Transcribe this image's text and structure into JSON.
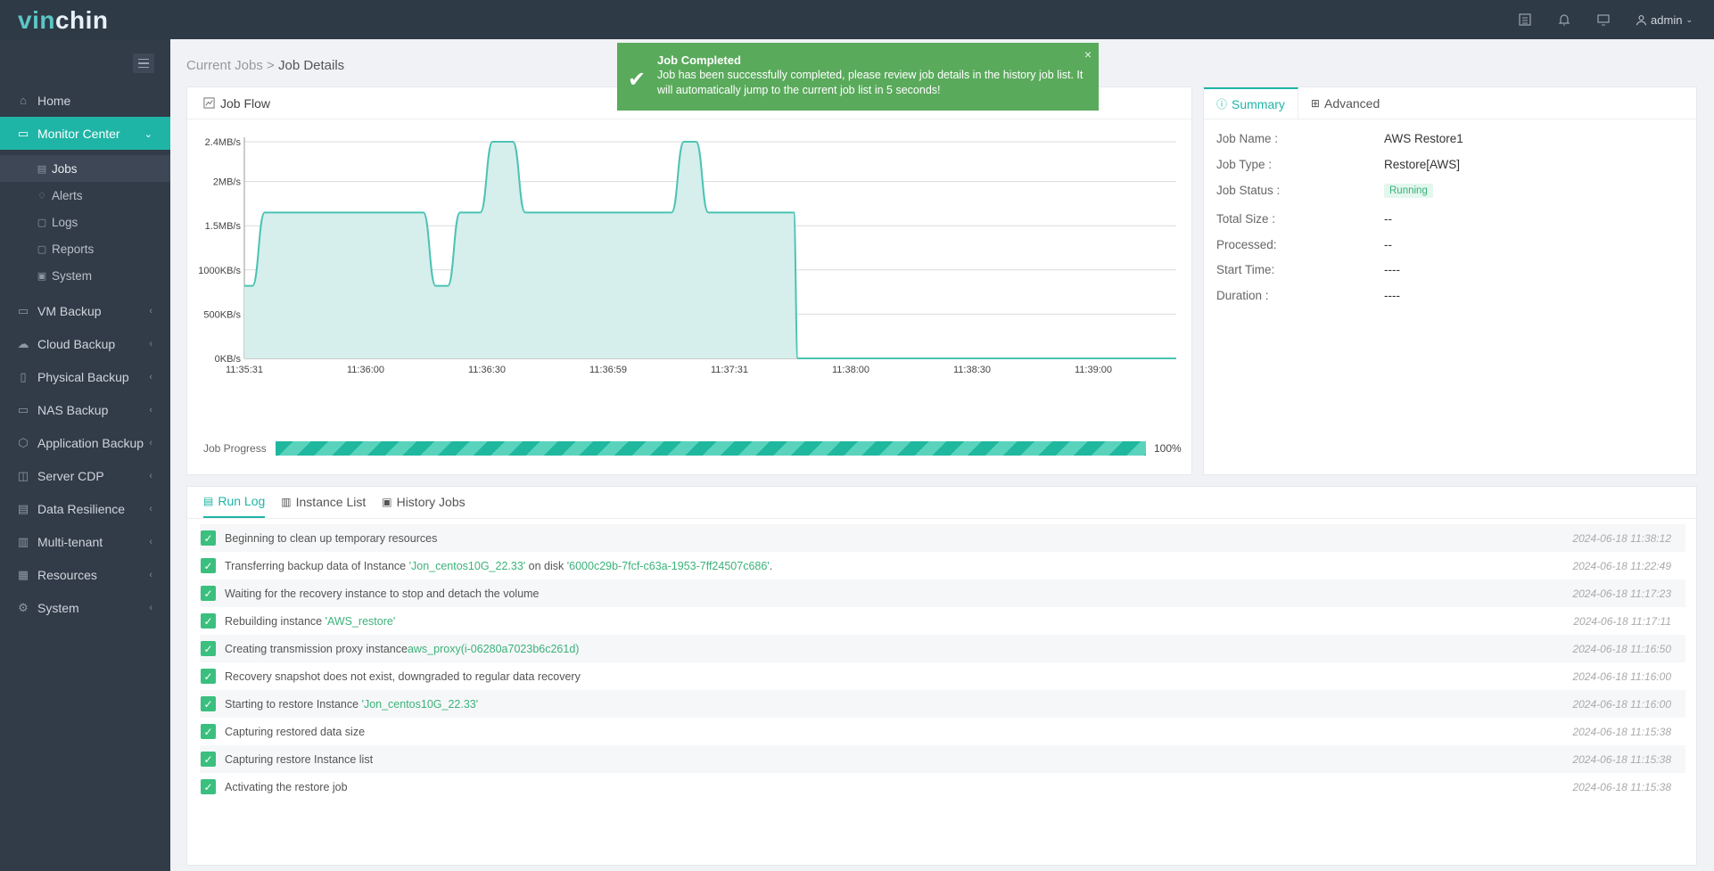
{
  "brand": {
    "logo_part1": "vin",
    "logo_part2": "chin"
  },
  "topbar": {
    "user": "admin",
    "icons": [
      "list-icon",
      "bell-icon",
      "monitor-icon",
      "user-icon",
      "chevron-down-icon"
    ]
  },
  "sidebar": {
    "items": [
      {
        "label": "Home",
        "icon": "home-icon"
      },
      {
        "label": "Monitor Center",
        "icon": "monitor-icon",
        "active": true
      },
      {
        "label": "VM Backup",
        "icon": "vm-icon"
      },
      {
        "label": "Cloud Backup",
        "icon": "cloud-icon"
      },
      {
        "label": "Physical Backup",
        "icon": "server-icon"
      },
      {
        "label": "NAS Backup",
        "icon": "nas-icon"
      },
      {
        "label": "Application Backup",
        "icon": "app-icon"
      },
      {
        "label": "Server CDP",
        "icon": "cdp-icon"
      },
      {
        "label": "Data Resilience",
        "icon": "resilience-icon"
      },
      {
        "label": "Multi-tenant",
        "icon": "tenant-icon"
      },
      {
        "label": "Resources",
        "icon": "resources-icon"
      },
      {
        "label": "System",
        "icon": "gear-icon"
      }
    ],
    "subitems": [
      {
        "label": "Jobs",
        "active": true
      },
      {
        "label": "Alerts"
      },
      {
        "label": "Logs"
      },
      {
        "label": "Reports"
      },
      {
        "label": "System"
      }
    ]
  },
  "breadcrumb": {
    "parent": "Current Jobs",
    "separator": ">",
    "current": "Job Details"
  },
  "jobflow": {
    "title": "Job Flow",
    "progress_label": "Job Progress",
    "progress_value": 100,
    "progress_text": "100%"
  },
  "chart_data": {
    "type": "area",
    "x": [
      "11:35:31",
      "11:36:00",
      "11:36:30",
      "11:36:59",
      "11:37:31",
      "11:38:00",
      "11:38:30",
      "11:39:00"
    ],
    "y_ticks": [
      "0KB/s",
      "500KB/s",
      "1000KB/s",
      "1.5MB/s",
      "2MB/s",
      "2.4MB/s"
    ],
    "ylim": [
      0,
      2.5
    ],
    "y_unit": "MB/s",
    "points": [
      [
        0,
        0.82
      ],
      [
        2,
        0.82
      ],
      [
        5,
        1.65
      ],
      [
        44,
        1.65
      ],
      [
        47,
        0.82
      ],
      [
        50,
        0.82
      ],
      [
        53,
        1.65
      ],
      [
        58,
        1.65
      ],
      [
        61,
        2.45
      ],
      [
        66,
        2.45
      ],
      [
        69,
        1.65
      ],
      [
        105,
        1.65
      ],
      [
        108,
        2.45
      ],
      [
        111,
        2.45
      ],
      [
        114,
        1.65
      ],
      [
        135,
        1.65
      ],
      [
        136,
        0
      ],
      [
        229,
        0
      ]
    ],
    "x_range": [
      0,
      229
    ],
    "grid": true
  },
  "summary": {
    "tabs": [
      {
        "label": "Summary",
        "active": true
      },
      {
        "label": "Advanced"
      }
    ],
    "rows": [
      {
        "key": "Job Name :",
        "value": "AWS Restore1"
      },
      {
        "key": "Job Type :",
        "value": "Restore[AWS]"
      },
      {
        "key": "Job Status :",
        "value": "Running",
        "badge": true
      },
      {
        "key": "Total Size :",
        "value": "--"
      },
      {
        "key": "Processed:",
        "value": "--"
      },
      {
        "key": "Start Time:",
        "value": "----"
      },
      {
        "key": "Duration :",
        "value": "----"
      }
    ]
  },
  "runlog": {
    "tabs": [
      {
        "label": "Run Log",
        "active": true
      },
      {
        "label": "Instance List"
      },
      {
        "label": "History Jobs"
      }
    ],
    "entries": [
      {
        "parts": [
          {
            "t": "Beginning to clean up temporary resources"
          }
        ],
        "ts": "2024-06-18 11:38:12"
      },
      {
        "parts": [
          {
            "t": "Transferring backup data of Instance "
          },
          {
            "t": "'Jon_centos10G_22.33'",
            "hl": true
          },
          {
            "t": " on disk "
          },
          {
            "t": "'6000c29b-7fcf-c63a-1953-7ff24507c686'",
            "hl": true
          },
          {
            "t": "."
          }
        ],
        "ts": "2024-06-18 11:22:49"
      },
      {
        "parts": [
          {
            "t": "Waiting for the recovery instance to stop and detach the volume"
          }
        ],
        "ts": "2024-06-18 11:17:23"
      },
      {
        "parts": [
          {
            "t": "Rebuilding instance "
          },
          {
            "t": "'AWS_restore'",
            "hl": true
          }
        ],
        "ts": "2024-06-18 11:17:11"
      },
      {
        "parts": [
          {
            "t": "Creating transmission proxy instance"
          },
          {
            "t": "aws_proxy(i-06280a7023b6c261d)",
            "hl": true
          }
        ],
        "ts": "2024-06-18 11:16:50"
      },
      {
        "parts": [
          {
            "t": "Recovery snapshot does not exist, downgraded to regular data recovery"
          }
        ],
        "ts": "2024-06-18 11:16:00"
      },
      {
        "parts": [
          {
            "t": "Starting to restore Instance "
          },
          {
            "t": "'Jon_centos10G_22.33'",
            "hl": true
          }
        ],
        "ts": "2024-06-18 11:16:00"
      },
      {
        "parts": [
          {
            "t": "Capturing restored data size"
          }
        ],
        "ts": "2024-06-18 11:15:38"
      },
      {
        "parts": [
          {
            "t": "Capturing restore Instance list"
          }
        ],
        "ts": "2024-06-18 11:15:38"
      },
      {
        "parts": [
          {
            "t": "Activating the restore job"
          }
        ],
        "ts": "2024-06-18 11:15:38"
      }
    ]
  },
  "toast": {
    "title": "Job Completed",
    "message": "Job has been successfully completed, please review job details in the history job list. It will automatically jump to the current job list in 5 seconds!",
    "close": "×"
  },
  "colors": {
    "accent": "#1fb5a6",
    "sidebar": "#323b48",
    "topbar": "#2f3a47",
    "success": "#5aaa5c"
  }
}
